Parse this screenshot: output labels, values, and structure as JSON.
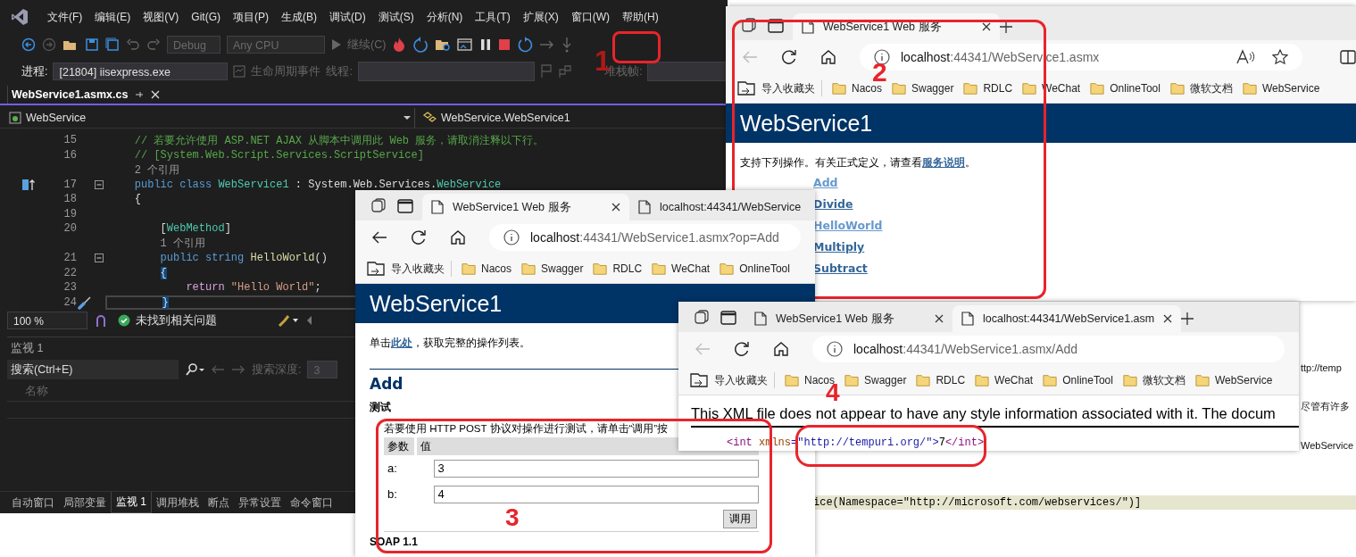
{
  "vs": {
    "menu": [
      "文件(F)",
      "编辑(E)",
      "视图(V)",
      "Git(G)",
      "项目(P)",
      "生成(B)",
      "调试(D)",
      "测试(S)",
      "分析(N)",
      "工具(T)",
      "扩展(X)",
      "窗口(W)",
      "帮助(H)"
    ],
    "config": "Debug",
    "platform": "Any CPU",
    "continue": "继续(C)",
    "process_label": "进程:",
    "process": "[21804] iisexpress.exe",
    "lifecycle": "生命周期事件",
    "thread_label": "线程:",
    "stack_label": "堆栈帧:",
    "doc_tab": "WebService1.asmx.cs",
    "nav": [
      "WebService",
      "WebService.WebService1"
    ],
    "code": [
      {
        "number": "15",
        "tokens": [
          {
            "text": "    // 若要允许使用 ASP.NET AJAX 从脚本中调用此 Web 服务，请取消注释以下行。",
            "kind": "comment"
          }
        ]
      },
      {
        "number": "16",
        "tokens": [
          {
            "text": "    // [System.Web.Script.Services.ScriptService]",
            "kind": "comment"
          }
        ]
      },
      {
        "tokens": [
          {
            "text": "    2 个引用",
            "kind": "lens"
          }
        ]
      },
      {
        "number": "17",
        "marker": true,
        "collapsible": true,
        "tokens": [
          {
            "text": "    public class ",
            "kind": "keyword"
          },
          {
            "text": "WebService1",
            "kind": "type"
          },
          {
            "text": " : System.Web.Services.",
            "kind": "plain"
          },
          {
            "text": "WebService",
            "kind": "type"
          }
        ]
      },
      {
        "number": "18",
        "tokens": [
          {
            "text": "    {",
            "kind": "plain"
          }
        ]
      },
      {
        "number": "19"
      },
      {
        "number": "20",
        "tokens": [
          {
            "text": "        [",
            "kind": "plain"
          },
          {
            "text": "WebMethod",
            "kind": "type"
          },
          {
            "text": "]",
            "kind": "plain"
          }
        ]
      },
      {
        "tokens": [
          {
            "text": "        1 个引用",
            "kind": "lens"
          }
        ]
      },
      {
        "number": "21",
        "collapsible": true,
        "tokens": [
          {
            "text": "        public string ",
            "kind": "keyword"
          },
          {
            "text": "HelloWorld",
            "kind": "method"
          },
          {
            "text": "()",
            "kind": "plain"
          }
        ]
      },
      {
        "number": "22",
        "tokens": [
          {
            "text": "        {",
            "kind": "brace"
          }
        ]
      },
      {
        "number": "23",
        "tokens": [
          {
            "text": "            return ",
            "kind": "control"
          },
          {
            "text": "\"Hello World\"",
            "kind": "string"
          },
          {
            "text": ";",
            "kind": "plain"
          }
        ]
      },
      {
        "number": "24",
        "current": true,
        "quick_action": true,
        "tokens": [
          {
            "text": "        }",
            "kind": "brace"
          }
        ]
      }
    ],
    "zoom": "100 %",
    "issues": "未找到相关问题",
    "watch": {
      "title": "监视 1",
      "placeholder": "搜索(Ctrl+E)",
      "depth_label": "搜索深度:",
      "depth": "3",
      "column": "名称"
    },
    "bottom_tabs": [
      {
        "label": "自动窗口",
        "selected": false
      },
      {
        "label": "局部变量",
        "selected": false
      },
      {
        "label": "监视 1",
        "selected": true
      },
      {
        "label": "调用堆栈",
        "selected": false
      },
      {
        "label": "断点",
        "selected": false
      },
      {
        "label": "异常设置",
        "selected": false
      },
      {
        "label": "命令窗口",
        "selected": false
      }
    ]
  },
  "back_window": {
    "fragments": [
      "ttp://temp",
      "尽管有许多",
      "WebService"
    ],
    "code_line": "ice(Namespace=\"http://microsoft.com/webservices/\")]"
  },
  "browsers": [
    {
      "tabs": [
        {
          "title": "WebService1 Web 服务",
          "selected": true,
          "close_button": true
        }
      ],
      "new_tab": true,
      "address": {
        "host": "localhost",
        "path": ":44341/WebService1.asmx"
      },
      "bookmarks": [
        {
          "label": "导入收藏夹",
          "kind": "import"
        },
        {
          "label": "Nacos",
          "kind": "folder"
        },
        {
          "label": "Swagger",
          "kind": "folder"
        },
        {
          "label": "RDLC",
          "kind": "folder"
        },
        {
          "label": "WeChat",
          "kind": "folder"
        },
        {
          "label": "OnlineTool",
          "kind": "folder"
        },
        {
          "label": "微软文档",
          "kind": "folder"
        },
        {
          "label": "WebService",
          "kind": "folder"
        }
      ],
      "page": {
        "kind": "service_list",
        "title": "WebService1",
        "intro": {
          "before": "支持下列操作。有关正式定义，请查看",
          "link": "服务说明",
          "after": "。"
        },
        "operations": [
          {
            "name": "Add",
            "visited": true
          },
          {
            "name": "Divide",
            "visited": false
          },
          {
            "name": "HelloWorld",
            "visited": true
          },
          {
            "name": "Multiply",
            "visited": false
          },
          {
            "name": "Subtract",
            "visited": false
          }
        ]
      }
    },
    {
      "tabs": [
        {
          "title": "WebService1 Web 服务",
          "selected": true,
          "close_button": true
        },
        {
          "title": "localhost:44341/WebService",
          "selected": false,
          "close_button": false
        }
      ],
      "new_tab": false,
      "address": {
        "host": "localhost",
        "path": ":44341/WebService1.asmx?op=Add"
      },
      "bookmarks": [
        {
          "label": "导入收藏夹",
          "kind": "import"
        },
        {
          "label": "Nacos",
          "kind": "folder"
        },
        {
          "label": "Swagger",
          "kind": "folder"
        },
        {
          "label": "RDLC",
          "kind": "folder"
        },
        {
          "label": "WeChat",
          "kind": "folder"
        },
        {
          "label": "OnlineTool",
          "kind": "folder"
        }
      ],
      "page": {
        "kind": "operation",
        "title": "WebService1",
        "intro": {
          "before": "单击",
          "link": "此处",
          "after": "，获取完整的操作列表。"
        },
        "heading": "Add",
        "section": "测试",
        "note": "若要使用 HTTP POST 协议对操作进行测试，请单击“调用”按",
        "columns": [
          "参数",
          "值"
        ],
        "params": [
          {
            "name": "a:",
            "value": "3"
          },
          {
            "name": "b:",
            "value": "4"
          }
        ],
        "submit": "调用",
        "next_section": "SOAP 1.1"
      }
    },
    {
      "tabs": [
        {
          "title": "WebService1 Web 服务",
          "selected": false,
          "close_button": true
        },
        {
          "title": "localhost:44341/WebService1.asm",
          "selected": true,
          "close_button": true
        }
      ],
      "new_tab": true,
      "address": {
        "host": "localhost",
        "path": ":44341/WebService1.asmx/Add"
      },
      "bookmarks": [
        {
          "label": "导入收藏夹",
          "kind": "import"
        },
        {
          "label": "Nacos",
          "kind": "folder"
        },
        {
          "label": "Swagger",
          "kind": "folder"
        },
        {
          "label": "RDLC",
          "kind": "folder"
        },
        {
          "label": "WeChat",
          "kind": "folder"
        },
        {
          "label": "OnlineTool",
          "kind": "folder"
        },
        {
          "label": "微软文档",
          "kind": "folder"
        },
        {
          "label": "WebService",
          "kind": "folder"
        }
      ],
      "page": {
        "kind": "xml",
        "notice": "This XML file does not appear to have any style information associated with it. The docum",
        "xml": [
          {
            "text": "<int",
            "kind": "tag"
          },
          {
            "text": " xmlns",
            "kind": "attr"
          },
          {
            "text": "=\"",
            "kind": "punct"
          },
          {
            "text": "http://tempuri.org/",
            "kind": "value"
          },
          {
            "text": "\">",
            "kind": "punct"
          },
          {
            "text": "7",
            "kind": "text"
          },
          {
            "text": "</int>",
            "kind": "tag"
          }
        ]
      }
    }
  ],
  "annotations": [
    "1",
    "2",
    "3",
    "4"
  ]
}
